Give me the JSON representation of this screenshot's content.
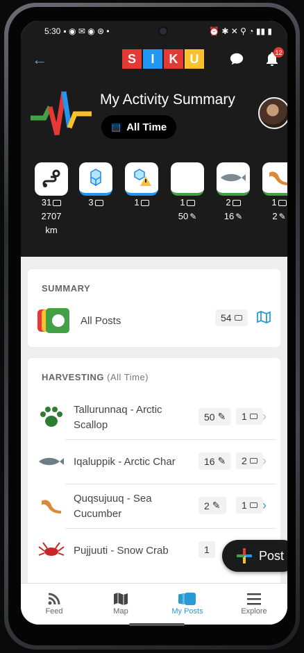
{
  "status": {
    "time": "5:30"
  },
  "appbar": {
    "logo_letters": [
      "S",
      "I",
      "K",
      "U"
    ],
    "logo_colors": [
      "#e53935",
      "#2196f3",
      "#e53935",
      "#fbc02d"
    ],
    "notification_count": "12"
  },
  "header": {
    "title": "My Activity Summary",
    "filter_label": "All Time"
  },
  "tiles": [
    {
      "icon": "route-icon",
      "count": "31",
      "line2": "2707",
      "line3": "km"
    },
    {
      "icon": "ice-blocks-icon",
      "count": "3",
      "line2": "",
      "line3": ""
    },
    {
      "icon": "ice-warning-icon",
      "count": "1",
      "line2": "",
      "line3": ""
    },
    {
      "icon": "scallop-icon",
      "count": "1",
      "line2": "50",
      "line3": ""
    },
    {
      "icon": "arctic-char-icon",
      "count": "2",
      "line2": "16",
      "line3": ""
    },
    {
      "icon": "sea-cucumber-icon",
      "count": "1",
      "line2": "2",
      "line3": ""
    }
  ],
  "summary": {
    "heading": "SUMMARY",
    "all_posts_label": "All Posts",
    "all_posts_count": "54"
  },
  "harvesting": {
    "heading": "HARVESTING",
    "subheading": "(All Time)",
    "rows": [
      {
        "name": "Tallurunnaq - Arctic Scallop",
        "count_pencil": "50",
        "count_posts": "1",
        "icon": "paw-icon"
      },
      {
        "name": "Iqaluppik - Arctic Char",
        "count_pencil": "16",
        "count_posts": "2",
        "icon": "fish-icon"
      },
      {
        "name": "Quqsujuuq - Sea Cucumber",
        "count_pencil": "2",
        "count_posts": "1",
        "icon": "sea-cucumber-icon"
      },
      {
        "name": "Pujjuuti - Snow Crab",
        "count_pencil": "1",
        "count_posts": "",
        "icon": "crab-icon"
      }
    ]
  },
  "fab": {
    "label": "Post"
  },
  "nav": [
    {
      "label": "Feed",
      "icon": "rss-icon"
    },
    {
      "label": "Map",
      "icon": "map-icon"
    },
    {
      "label": "My Posts",
      "icon": "posts-icon"
    },
    {
      "label": "Explore",
      "icon": "menu-icon"
    }
  ],
  "colors": {
    "accent": "#2a9ad6",
    "header_bg": "#1b1b1b"
  }
}
